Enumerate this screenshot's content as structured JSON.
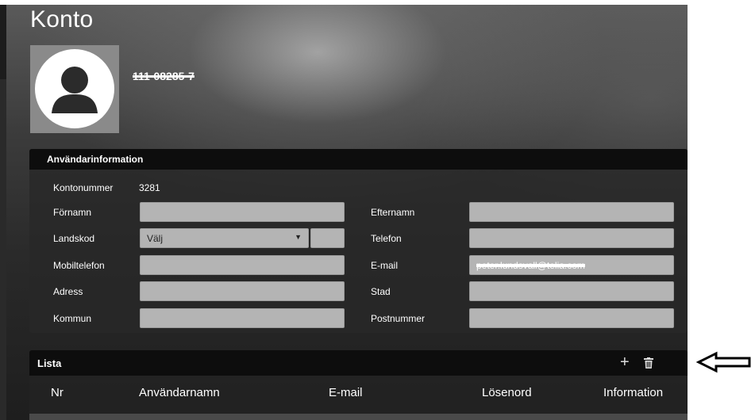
{
  "page": {
    "title": "Konto",
    "username": "111-08285-7"
  },
  "user_info": {
    "title": "Användarinformation",
    "account_number_label": "Kontonummer",
    "account_number_value": "3281",
    "fields": {
      "first_name_label": "Förnamn",
      "last_name_label": "Efternamn",
      "country_code_label": "Landskod",
      "country_code_value": "Välj",
      "phone_label": "Telefon",
      "mobile_label": "Mobiltelefon",
      "email_label": "E-mail",
      "email_value": "peter.lundsvall@telia.com",
      "address_label": "Adress",
      "city_label": "Stad",
      "municipality_label": "Kommun",
      "postal_code_label": "Postnummer"
    }
  },
  "list": {
    "title": "Lista",
    "add_icon": "plus-icon",
    "delete_icon": "trash-icon",
    "columns": [
      "Nr",
      "Användarnamn",
      "E-mail",
      "Lösenord",
      "Information"
    ]
  },
  "annotation": {
    "icon": "left-arrow-icon"
  },
  "colors": {
    "field_bg": "#b4b4b4",
    "header_bg": "#0d0d0d",
    "text": "#ffffff"
  }
}
